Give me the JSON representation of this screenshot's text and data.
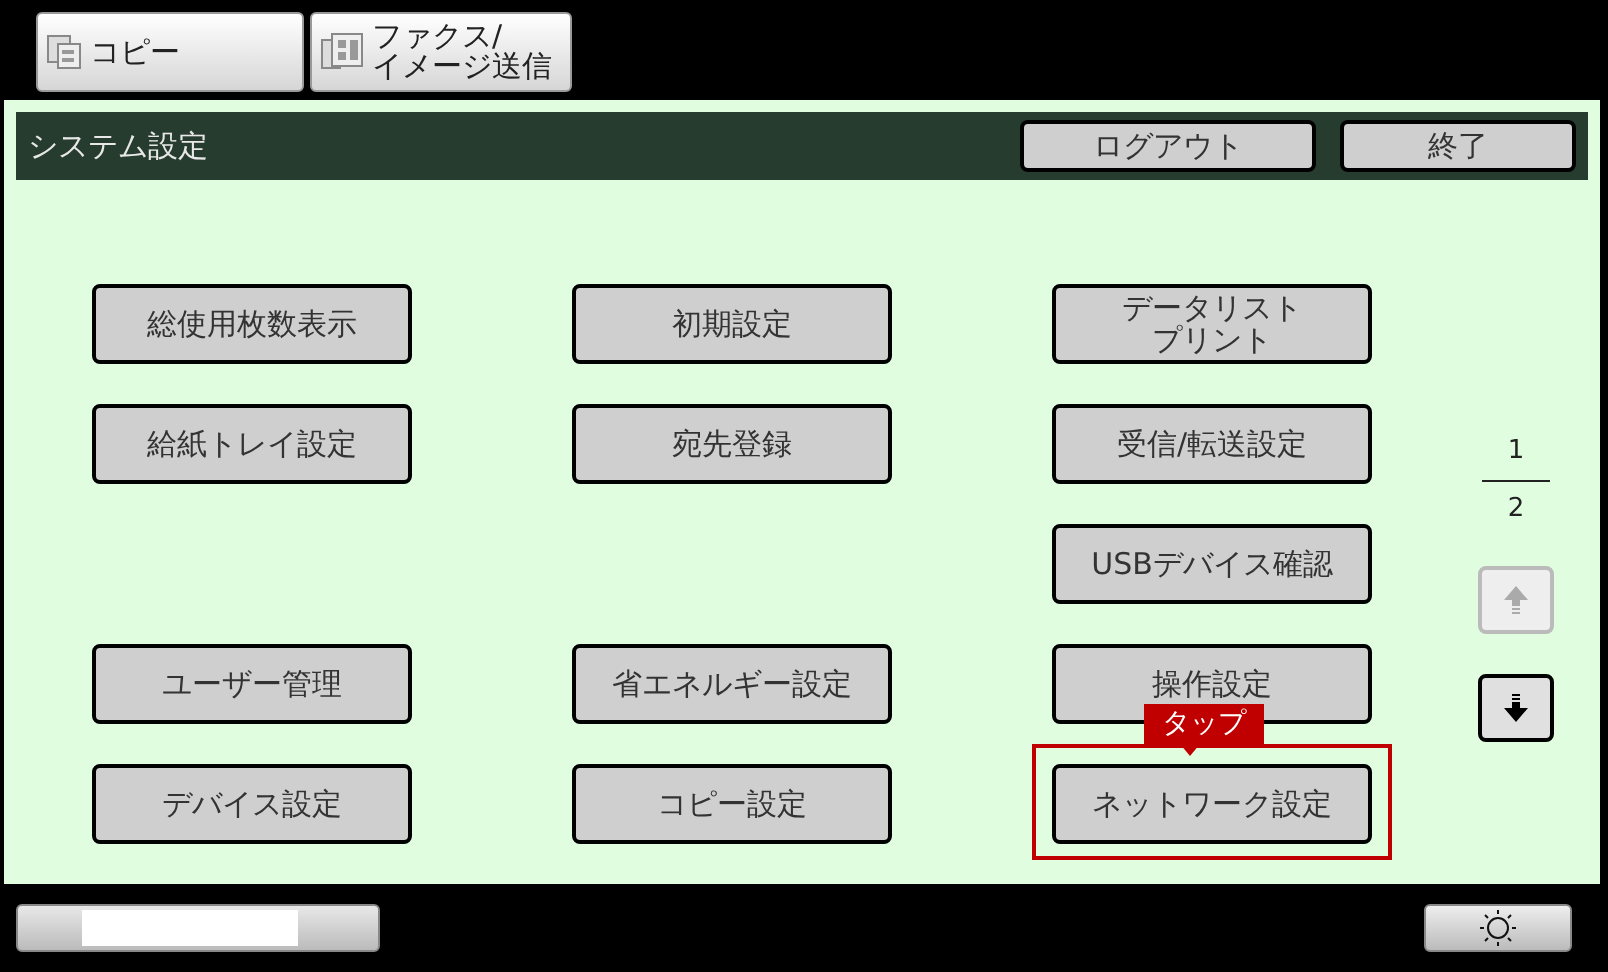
{
  "mode_tabs": [
    {
      "lines": [
        "コピー"
      ]
    },
    {
      "lines": [
        "ファクス/",
        "イメージ送信"
      ]
    }
  ],
  "header": {
    "title": "システム設定",
    "buttons": [
      "ログアウト",
      "終了"
    ]
  },
  "grid": [
    [
      {
        "kind": "button",
        "label": "総使用枚数表示"
      },
      {
        "kind": "button",
        "label": "初期設定"
      },
      {
        "kind": "button",
        "lines": [
          "データリスト",
          "プリント"
        ]
      }
    ],
    [
      {
        "kind": "button",
        "label": "給紙トレイ設定"
      },
      {
        "kind": "button",
        "label": "宛先登録"
      },
      {
        "kind": "button",
        "label": "受信/転送設定"
      }
    ],
    [
      {
        "kind": "blank"
      },
      {
        "kind": "blank"
      },
      {
        "kind": "button",
        "label": "USBデバイス確認"
      }
    ],
    [
      {
        "kind": "button",
        "label": "ユーザー管理"
      },
      {
        "kind": "button",
        "label": "省エネルギー設定"
      },
      {
        "kind": "button",
        "label": "操作設定"
      }
    ],
    [
      {
        "kind": "button",
        "label": "デバイス設定"
      },
      {
        "kind": "button",
        "label": "コピー設定"
      },
      {
        "kind": "button",
        "label": "ネットワーク設定",
        "highlighted": true,
        "callout": "タップ"
      }
    ]
  ],
  "pager": {
    "current": "1",
    "total": "2",
    "up_disabled": true,
    "down_disabled": false
  }
}
